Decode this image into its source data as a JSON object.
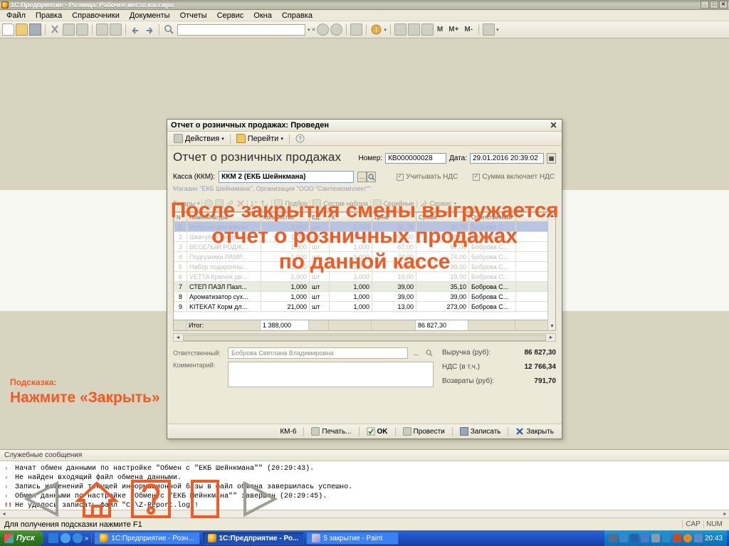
{
  "app": {
    "title": "1С:Предприятие - Розница: Рабочее место кассира",
    "window_buttons": [
      "_",
      "□",
      "✕"
    ],
    "menu": [
      "Файл",
      "Правка",
      "Справочники",
      "Документы",
      "Отчеты",
      "Сервис",
      "Окна",
      "Справка"
    ],
    "toolbar_text_buttons": [
      "M",
      "M+",
      "M-"
    ],
    "search_value": ""
  },
  "dialog": {
    "title": "Отчет о розничных продажах: Проведен",
    "close_label": "✕",
    "toolbar": [
      {
        "label": "Действия",
        "icon": "actions-icon",
        "caret": "▾"
      },
      {
        "label": "Перейти",
        "icon": "goto-icon",
        "caret": "▾"
      },
      {
        "label": "",
        "icon": "help-icon",
        "caret": ""
      }
    ],
    "heading": "Отчет о розничных продажах",
    "number_label": "Номер:",
    "number_value": "КВ000000028",
    "date_label": "Дата:",
    "date_value": "29.01.2016 20:39:02",
    "kassa_label": "Касса (ККМ):",
    "kassa_value": "ККМ 2 (ЕКБ Шейнкмана)",
    "checkbox_vat": "Учитывать НДС",
    "checkbox_sum_includes_vat": "Сумма включает НДС",
    "sub_note": "Магазин \"ЕКБ Шейнкмана\", Организация \"ООО \"Сантехкомплект\"\"",
    "table_toolbar": [
      {
        "label": "Товары",
        "caret": "▾"
      },
      {
        "label": "Подбор",
        "caret": ""
      },
      {
        "label": "Состав набора",
        "caret": ""
      },
      {
        "label": "Серийные",
        "caret": ""
      },
      {
        "label": "Сервис",
        "caret": "▾"
      }
    ],
    "grid": {
      "columns": [
        "N",
        "Номенклатура",
        "Количество",
        "Ед.",
        "К",
        "Цена",
        "Сумма",
        "Ответственный",
        ""
      ],
      "rows": [
        {
          "n": "1",
          "name": "Игрушка для ванны",
          "qty": "1,000",
          "unit": "шт",
          "k": "1,000",
          "price": "35,00",
          "sum": "35,00",
          "resp": "Боброва С...",
          "style": "sel"
        },
        {
          "n": "2",
          "name": "Шкатулка сундучо...",
          "qty": "1,000",
          "unit": "шт",
          "k": "1,000",
          "price": "339,00",
          "sum": "339,00",
          "resp": "Боброва С...",
          "style": "faded"
        },
        {
          "n": "3",
          "name": "ВЕСЕЛЫЙ РОДЖ...",
          "qty": "1,000",
          "unit": "шт",
          "k": "1,000",
          "price": "67,00",
          "sum": "67,00",
          "resp": "Боброва С...",
          "style": "faded"
        },
        {
          "n": "4",
          "name": "Подгузники PAMP...",
          "qty": "1,000",
          "unit": "шт",
          "k": "1,000",
          "price": "74,00",
          "sum": "74,00",
          "resp": "Боброва С...",
          "style": "faded"
        },
        {
          "n": "5",
          "name": "Набор подарочны...",
          "qty": "1,000",
          "unit": "шт",
          "k": "1,000",
          "price": "99,00",
          "sum": "99,00",
          "resp": "Боброва С...",
          "style": "faded"
        },
        {
          "n": "6",
          "name": "VETTA Крючок дв...",
          "qty": "1,000",
          "unit": "шт",
          "k": "1,000",
          "price": "19,00",
          "sum": "19,00",
          "resp": "Боброва С...",
          "style": "faded"
        },
        {
          "n": "7",
          "name": "СТЕП ПАЗЛ Пазл...",
          "qty": "1,000",
          "unit": "шт",
          "k": "1,000",
          "price": "39,00",
          "sum": "35,10",
          "resp": "Боброва С...",
          "style": "hl"
        },
        {
          "n": "8",
          "name": "Ароматизатор сух...",
          "qty": "1,000",
          "unit": "шт",
          "k": "1,000",
          "price": "39,00",
          "sum": "39,00",
          "resp": "Боброва С...",
          "style": ""
        },
        {
          "n": "9",
          "name": "KITEKAT Корм дл...",
          "qty": "21,000",
          "unit": "шт",
          "k": "1,000",
          "price": "13,00",
          "sum": "273,00",
          "resp": "Боброва С...",
          "style": ""
        }
      ],
      "footer_label": "Итог:",
      "footer_qty": "1 388,000",
      "footer_sum": "86 827,30"
    },
    "responsible_label": "Ответственный:",
    "responsible_value": "Боброва Светлана Владимировна",
    "comment_label": "Комментарий:",
    "comment_value": "",
    "totals": [
      {
        "label": "Выручка (руб):",
        "value": "86 827,30"
      },
      {
        "label": "НДС (в т.ч.)",
        "value": "12 766,34"
      },
      {
        "label": "Возвраты (руб):",
        "value": "791,70"
      }
    ],
    "footer_buttons": [
      {
        "label": "КМ-6",
        "icon": "",
        "bold": false
      },
      {
        "label": "Печать...",
        "icon": "print-icon",
        "bold": false
      },
      {
        "label": "OK",
        "icon": "ok-icon",
        "bold": true
      },
      {
        "label": "Провести",
        "icon": "post-icon",
        "bold": false
      },
      {
        "label": "Записать",
        "icon": "save-icon",
        "bold": false
      },
      {
        "label": "Закрыть",
        "icon": "close-x-icon",
        "bold": false
      }
    ]
  },
  "service_messages": {
    "title": "Служебные сообщения",
    "lines": [
      {
        "mark": "›",
        "error": false,
        "text": "Начат обмен данными по настройке \"Обмен с \"ЕКБ Шейнкмана\"\" (20:29:43)."
      },
      {
        "mark": "›",
        "error": false,
        "text": "Не найден входящий файл обмена данными."
      },
      {
        "mark": "›",
        "error": false,
        "text": "Запись изменений текущей информационной базы в файл обмена завершилась успешно."
      },
      {
        "mark": "›",
        "error": false,
        "text": "Обмен данными по настройке \"Обмен с \"ЕКБ Шейнкмана\"\" завершен (20:29:45)."
      },
      {
        "mark": "!!",
        "error": true,
        "text": "Не удалось записать файл \"C:\\Z-Report.log\"!"
      }
    ]
  },
  "statusbar": {
    "text": "Для получения подсказки нажмите F1",
    "indicators": [
      "CAP",
      "NUM"
    ]
  },
  "taskbar": {
    "start_label": "Пуск",
    "quicklaunch_more": "»",
    "tasks": [
      {
        "label": "1С:Предприятие - Розн...",
        "active": false
      },
      {
        "label": "1С:Предприятие - Ро...",
        "active": true
      },
      {
        "label": "5 закрытие - Paint",
        "active": false
      }
    ],
    "clock": "20:43"
  },
  "overlay": {
    "line1": "После закрытия смены выгружается",
    "line2": "отчет о розничных продажах",
    "line3": "по данной кассе",
    "hint_label": "Подсказка:",
    "hint_text": "Нажмите «Закрыть»",
    "accent_color": "#f15a22"
  },
  "nav_buttons": [
    {
      "name": "prev",
      "glyph": "◁",
      "active": false
    },
    {
      "name": "home",
      "glyph": "⌂",
      "active": true
    },
    {
      "name": "help",
      "glyph": "?",
      "active": true
    },
    {
      "name": "doc",
      "glyph": "▯",
      "active": true
    },
    {
      "name": "next",
      "glyph": "▷",
      "active": false
    }
  ]
}
